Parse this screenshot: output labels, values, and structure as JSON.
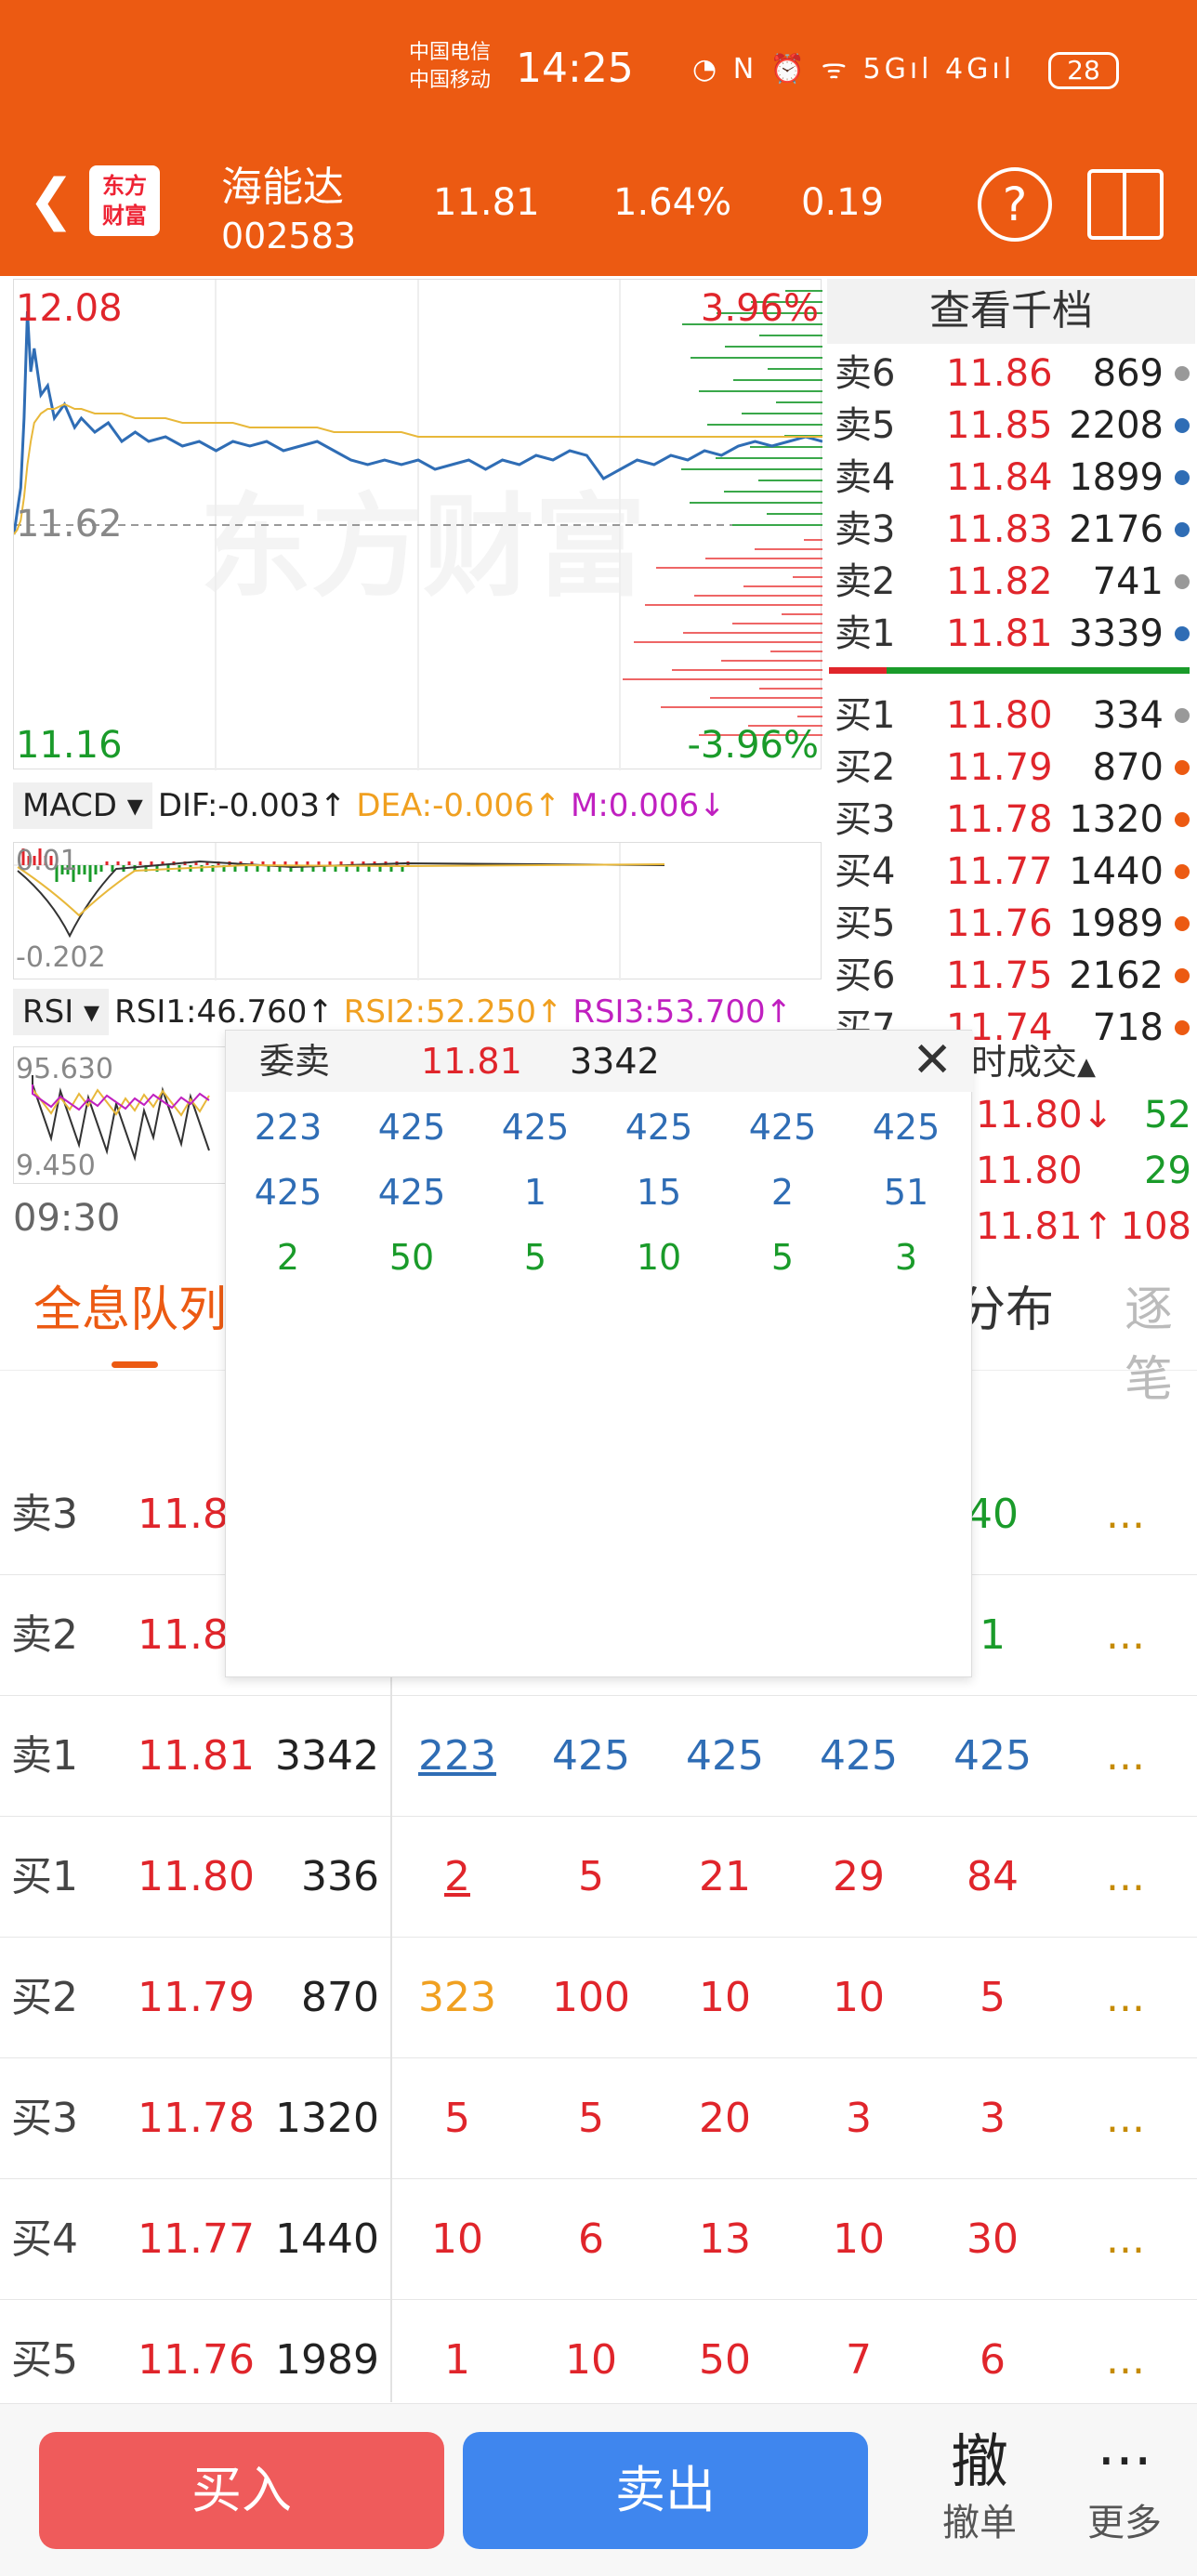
{
  "status_bar": {
    "carrier1": "中国电信",
    "carrier2": "中国移动",
    "time": "14:25",
    "icons": "◔ N ⏰ ᯤ 5Gıl 4Gıl",
    "battery": "28"
  },
  "header": {
    "name": "海能达",
    "code": "002583",
    "price": "11.81",
    "change_pct": "1.64%",
    "change": "0.19",
    "logo_line1": "东方",
    "logo_line2": "财富",
    "help": "?"
  },
  "chart": {
    "high": "12.08",
    "high_pct": "3.96%",
    "prev_close": "11.62",
    "low": "11.16",
    "low_pct": "-3.96%",
    "watermark": "东方财富",
    "time_start": "09:30"
  },
  "chart_data": {
    "type": "line",
    "ylim": [
      11.16,
      12.08
    ],
    "reference": 11.62,
    "x": [
      0,
      1,
      2,
      3,
      4,
      5,
      6,
      8,
      10,
      12,
      15,
      18,
      20,
      24,
      28,
      32,
      36,
      40,
      45,
      50,
      55,
      60,
      65,
      70,
      75,
      80,
      85,
      90,
      95,
      100,
      105,
      110,
      115,
      120,
      125,
      130,
      135,
      140,
      145,
      150,
      155,
      160,
      165,
      170,
      175,
      180,
      185,
      190,
      195,
      200,
      205,
      210,
      215,
      220,
      225,
      230,
      235,
      240
    ],
    "series": [
      {
        "color": "#2f6db5",
        "values": [
          11.6,
          11.65,
          11.7,
          11.85,
          12.08,
          11.95,
          12.0,
          11.9,
          11.92,
          11.85,
          11.88,
          11.83,
          11.85,
          11.82,
          11.84,
          11.8,
          11.82,
          11.8,
          11.81,
          11.79,
          11.8,
          11.78,
          11.8,
          11.79,
          11.8,
          11.78,
          11.79,
          11.8,
          11.78,
          11.76,
          11.75,
          11.76,
          11.75,
          11.76,
          11.74,
          11.75,
          11.76,
          11.74,
          11.76,
          11.75,
          11.77,
          11.76,
          11.78,
          11.77,
          11.72,
          11.74,
          11.76,
          11.75,
          11.77,
          11.76,
          11.78,
          11.77,
          11.79,
          11.8,
          11.79,
          11.8,
          11.81,
          11.8
        ]
      },
      {
        "color": "#e8b83a",
        "values": [
          11.6,
          11.61,
          11.63,
          11.68,
          11.75,
          11.8,
          11.84,
          11.86,
          11.87,
          11.87,
          11.88,
          11.87,
          11.87,
          11.86,
          11.86,
          11.86,
          11.85,
          11.85,
          11.85,
          11.84,
          11.84,
          11.84,
          11.84,
          11.83,
          11.83,
          11.83,
          11.83,
          11.83,
          11.82,
          11.82,
          11.82,
          11.82,
          11.82,
          11.81,
          11.81,
          11.81,
          11.81,
          11.81,
          11.81,
          11.81,
          11.81,
          11.81,
          11.81,
          11.81,
          11.81,
          11.81,
          11.81,
          11.81,
          11.81,
          11.81,
          11.81,
          11.81,
          11.81,
          11.81,
          11.81,
          11.81,
          11.81,
          11.81
        ]
      }
    ]
  },
  "macd": {
    "selector": "MACD",
    "dif": "DIF:-0.003",
    "dea": "DEA:-0.006",
    "m": "M:0.006",
    "top": "0.01",
    "bottom": "-0.202"
  },
  "rsi": {
    "selector": "RSI",
    "r1": "RSI1:46.760",
    "r2": "RSI2:52.250",
    "r3": "RSI3:53.700",
    "top": "95.630",
    "bottom": "9.450"
  },
  "arrows": {
    "up": "↑",
    "down": "↓",
    "caret": "▾",
    "tri_up": "▲"
  },
  "orderbook": {
    "title": "查看千档",
    "sells": [
      {
        "label": "卖6",
        "price": "11.86",
        "vol": "869",
        "dot": "#999"
      },
      {
        "label": "卖5",
        "price": "11.85",
        "vol": "2208",
        "dot": "#2f6db5"
      },
      {
        "label": "卖4",
        "price": "11.84",
        "vol": "1899",
        "dot": "#2f6db5"
      },
      {
        "label": "卖3",
        "price": "11.83",
        "vol": "2176",
        "dot": "#2f6db5"
      },
      {
        "label": "卖2",
        "price": "11.82",
        "vol": "741",
        "dot": "#999"
      },
      {
        "label": "卖1",
        "price": "11.81",
        "vol": "3339",
        "dot": "#2f6db5"
      }
    ],
    "buys": [
      {
        "label": "买1",
        "price": "11.80",
        "vol": "334",
        "dot": "#999"
      },
      {
        "label": "买2",
        "price": "11.79",
        "vol": "870",
        "dot": "#ec5a12"
      },
      {
        "label": "买3",
        "price": "11.78",
        "vol": "1320",
        "dot": "#ec5a12"
      },
      {
        "label": "买4",
        "price": "11.77",
        "vol": "1440",
        "dot": "#ec5a12"
      },
      {
        "label": "买5",
        "price": "11.76",
        "vol": "1989",
        "dot": "#ec5a12"
      },
      {
        "label": "买6",
        "price": "11.75",
        "vol": "2162",
        "dot": "#ec5a12"
      },
      {
        "label": "买7",
        "price": "11.74",
        "vol": "718",
        "dot": "#ec5a12"
      }
    ]
  },
  "trades": {
    "title": "时成交",
    "rows": [
      {
        "price": "11.80↓",
        "vol": "52",
        "pc": "red",
        "vc": "green"
      },
      {
        "price": "11.80",
        "vol": "29",
        "pc": "red",
        "vc": "green"
      },
      {
        "price": "11.81↑",
        "vol": "108",
        "pc": "red",
        "vc": "red"
      }
    ]
  },
  "tabs": {
    "active": "全息队列",
    "dist": "分布",
    "more": "逐笔"
  },
  "queue_rows": [
    {
      "label": "卖3",
      "price": "11.8",
      "vol": "",
      "q": [
        "",
        "",
        "",
        "",
        "40"
      ],
      "qc": "green"
    },
    {
      "label": "卖2",
      "price": "11.8",
      "vol": "",
      "q": [
        "",
        "",
        "",
        "",
        "1"
      ],
      "qc": "green"
    },
    {
      "label": "卖1",
      "price": "11.81",
      "vol": "3342",
      "q": [
        "223",
        "425",
        "425",
        "425",
        "425"
      ],
      "qc": "blue"
    },
    {
      "label": "买1",
      "price": "11.80",
      "vol": "336",
      "q": [
        "2",
        "5",
        "21",
        "29",
        "84"
      ],
      "qc": "red"
    },
    {
      "label": "买2",
      "price": "11.79",
      "vol": "870",
      "q": [
        "323",
        "100",
        "10",
        "10",
        "5"
      ],
      "qc": "red"
    },
    {
      "label": "买3",
      "price": "11.78",
      "vol": "1320",
      "q": [
        "5",
        "5",
        "20",
        "3",
        "3"
      ],
      "qc": "red"
    },
    {
      "label": "买4",
      "price": "11.77",
      "vol": "1440",
      "q": [
        "10",
        "6",
        "13",
        "10",
        "30"
      ],
      "qc": "red"
    },
    {
      "label": "买5",
      "price": "11.76",
      "vol": "1989",
      "q": [
        "1",
        "10",
        "50",
        "7",
        "6"
      ],
      "qc": "red"
    }
  ],
  "dots_label": "...",
  "popup": {
    "title": "委卖",
    "price": "11.81",
    "vol": "3342",
    "close": "✕",
    "rows": [
      [
        "223",
        "425",
        "425",
        "425",
        "425",
        "425"
      ],
      [
        "425",
        "425",
        "1",
        "15",
        "2",
        "51"
      ],
      [
        "2",
        "50",
        "5",
        "10",
        "5",
        "3"
      ]
    ],
    "row_colors": [
      "blue",
      "blue",
      "green"
    ]
  },
  "bottom": {
    "buy": "买入",
    "sell": "卖出",
    "cancel_icon": "撤",
    "cancel": "撤单",
    "more_icon": "···",
    "more": "更多"
  }
}
